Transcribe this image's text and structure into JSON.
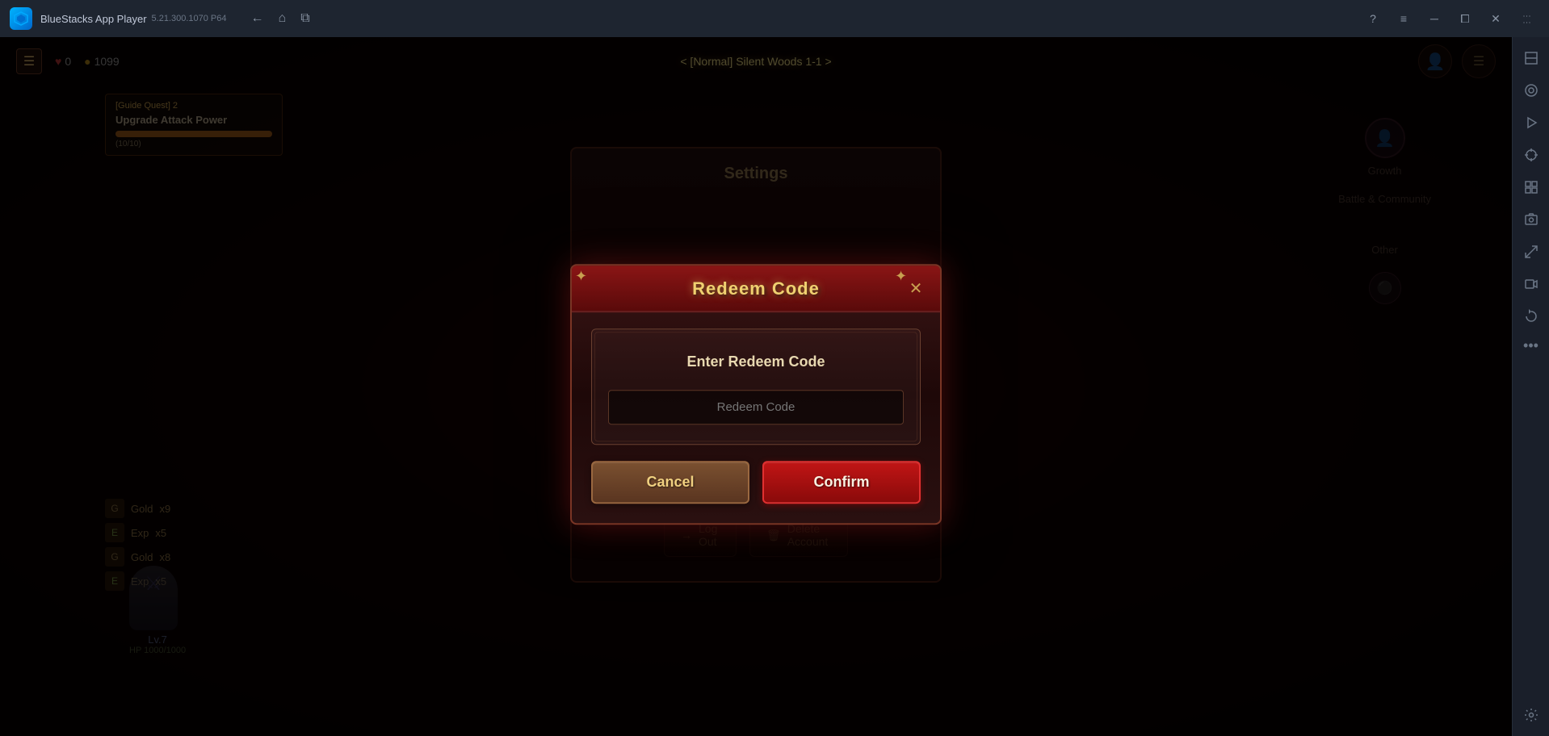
{
  "titlebar": {
    "app_name": "BlueStacks App Player",
    "version": "5.21.300.1070  P64",
    "nav": {
      "back": "←",
      "home": "⌂",
      "tabs": "⧉"
    },
    "controls": {
      "help": "?",
      "menu": "≡",
      "minimize": "─",
      "restore": "⧠",
      "close": "✕",
      "more": "⋮⋮"
    }
  },
  "game": {
    "top_bar": {
      "health_icon": "♥",
      "health_value": "0",
      "coin_icon": "●",
      "coin_value": "1099",
      "stage_title": "< [Normal] Silent Woods 1-1 >"
    },
    "quest": {
      "tag": "[Guide Quest] 2",
      "label": "Upgrade Attack Power",
      "progress": "200",
      "progress_text": "(10/10)"
    },
    "loot": [
      {
        "icon": "G",
        "label": "Gold",
        "count": "x9"
      },
      {
        "icon": "E",
        "label": "Exp",
        "count": "x5"
      },
      {
        "icon": "G",
        "label": "Gold",
        "count": "x8"
      },
      {
        "icon": "E",
        "label": "Exp",
        "count": "x5"
      }
    ],
    "character": {
      "level": "Lv.7",
      "hp": "HP 1000/1000"
    },
    "right_panel": {
      "growth_label": "Growth",
      "battle_label": "Battle & Community",
      "other_label": "Other"
    }
  },
  "settings_bg": {
    "title": "Settings",
    "logout_label": "Log Out",
    "delete_account_label": "Delete Account"
  },
  "redeem_modal": {
    "title": "Redeem Code",
    "close_icon": "✕",
    "inner_label": "Enter Redeem Code",
    "input_placeholder": "Redeem Code",
    "cancel_label": "Cancel",
    "confirm_label": "Confirm"
  },
  "sidebar": {
    "buttons": [
      {
        "icon": "⬍",
        "name": "resize-top-icon"
      },
      {
        "icon": "◉",
        "name": "camera-icon"
      },
      {
        "icon": "▶",
        "name": "play-icon"
      },
      {
        "icon": "⊙",
        "name": "target-icon"
      },
      {
        "icon": "⊞",
        "name": "grid-icon"
      },
      {
        "icon": "📷",
        "name": "screenshot-icon"
      },
      {
        "icon": "⬡",
        "name": "resize-icon"
      },
      {
        "icon": "📸",
        "name": "record-icon"
      },
      {
        "icon": "↺",
        "name": "rotate-icon"
      },
      {
        "icon": "⚙",
        "name": "settings-icon"
      }
    ],
    "dots": "•••"
  }
}
